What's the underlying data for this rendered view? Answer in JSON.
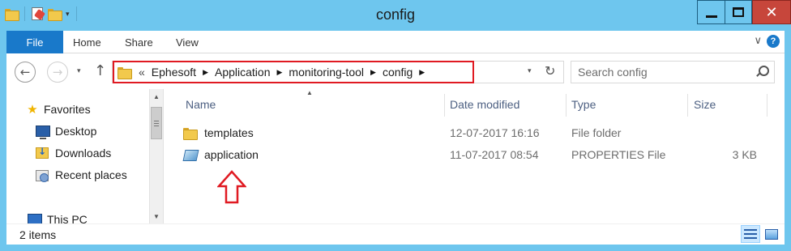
{
  "window": {
    "title": "config",
    "minimize_icon": "minimize-icon",
    "maximize_icon": "maximize-icon",
    "close_icon": "close-icon",
    "close_glyph": "✕"
  },
  "quick_access_toolbar": {
    "icons": [
      "folder-icon",
      "properties-icon",
      "new-folder-icon",
      "customize-dropdown-icon"
    ],
    "dropdown_glyph": "▾"
  },
  "ribbon": {
    "tabs": [
      {
        "label": "File"
      },
      {
        "label": "Home"
      },
      {
        "label": "Share"
      },
      {
        "label": "View"
      }
    ],
    "expand_glyph": "∨",
    "help_glyph": "?"
  },
  "navigation": {
    "back_glyph": "←",
    "forward_glyph": "→",
    "recent_dropdown_glyph": "▾",
    "up_glyph": "↑"
  },
  "address_bar": {
    "overflow": "«",
    "crumbs": [
      "Ephesoft",
      "Application",
      "monitoring-tool",
      "config"
    ],
    "separator": "▶",
    "dropdown_glyph": "▾",
    "refresh_glyph": "↻",
    "highlight_color": "#e01a22"
  },
  "search": {
    "placeholder": "Search config",
    "value": ""
  },
  "nav_pane": {
    "items": [
      {
        "label": "Favorites",
        "icon": "star-icon",
        "glyph": "★"
      },
      {
        "label": "Desktop",
        "icon": "desktop-icon"
      },
      {
        "label": "Downloads",
        "icon": "downloads-icon"
      },
      {
        "label": "Recent places",
        "icon": "recent-places-icon"
      },
      {
        "label": "This PC",
        "icon": "this-pc-icon"
      }
    ]
  },
  "scrollbar": {
    "up_glyph": "▲",
    "down_glyph": "▼"
  },
  "file_list": {
    "sort_glyph": "▲",
    "columns": [
      "Name",
      "Date modified",
      "Type",
      "Size"
    ],
    "rows": [
      {
        "name": "templates",
        "date_modified": "12-07-2017 16:16",
        "type": "File folder",
        "size": "",
        "icon": "folder-icon"
      },
      {
        "name": "application",
        "date_modified": "11-07-2017 08:54",
        "type": "PROPERTIES File",
        "size": "3 KB",
        "icon": "properties-file-icon"
      }
    ],
    "annotation_arrow_color": "#e01a22"
  },
  "status_bar": {
    "item_count": "2 items",
    "view_buttons": [
      "details-view-icon",
      "large-icons-view-icon"
    ]
  },
  "colors": {
    "title_bar": "#6ec6ee",
    "file_tab": "#1979ca",
    "close_button": "#c7463b"
  }
}
